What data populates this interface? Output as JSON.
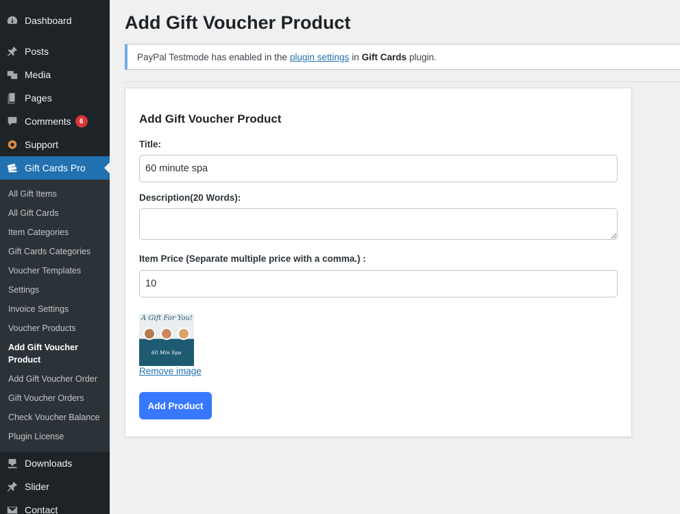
{
  "sidebar": {
    "top_items": [
      {
        "label": "Dashboard",
        "icon": "dashboard-icon"
      },
      {
        "label": "Posts",
        "icon": "pin-icon"
      },
      {
        "label": "Media",
        "icon": "media-icon"
      },
      {
        "label": "Pages",
        "icon": "pages-icon"
      },
      {
        "label": "Comments",
        "icon": "comment-icon",
        "badge": "6"
      },
      {
        "label": "Support",
        "icon": "support-icon"
      },
      {
        "label": "Gift Cards Pro",
        "icon": "gift-cards-icon",
        "active": true
      }
    ],
    "submenu": [
      "All Gift Items",
      "All Gift Cards",
      "Item Categories",
      "Gift Cards Categories",
      "Voucher Templates",
      "Settings",
      "Invoice Settings",
      "Voucher Products",
      "Add Gift Voucher Product",
      "Add Gift Voucher Order",
      "Gift Voucher Orders",
      "Check Voucher Balance",
      "Plugin License"
    ],
    "current_submenu": "Add Gift Voucher Product",
    "bottom_items": [
      {
        "label": "Downloads",
        "icon": "download-icon"
      },
      {
        "label": "Slider",
        "icon": "pin-icon"
      },
      {
        "label": "Contact",
        "icon": "mail-icon"
      }
    ]
  },
  "page": {
    "title": "Add Gift Voucher Product"
  },
  "notice": {
    "prefix": "PayPal Testmode has enabled in the",
    "link": "plugin settings",
    "middle": "in",
    "bold": "Gift Cards",
    "suffix": "plugin."
  },
  "form": {
    "heading": "Add Gift Voucher Product",
    "title_label": "Title:",
    "title_value": "60 minute spa",
    "description_label": "Description(20 Words):",
    "description_value": "",
    "price_label": "Item Price (Separate multiple price with a comma.) :",
    "price_value": "10",
    "image": {
      "script_text": "A Gift For You!",
      "sub_text": "60 Min Spa"
    },
    "remove_image_label": "Remove image",
    "submit_label": "Add Product"
  },
  "colors": {
    "sidebar_bg": "#1d2327",
    "submenu_bg": "#2c3338",
    "active_bg": "#2271b1",
    "button_bg": "#3878ff",
    "badge_bg": "#d63638",
    "notice_border": "#72aee6"
  }
}
